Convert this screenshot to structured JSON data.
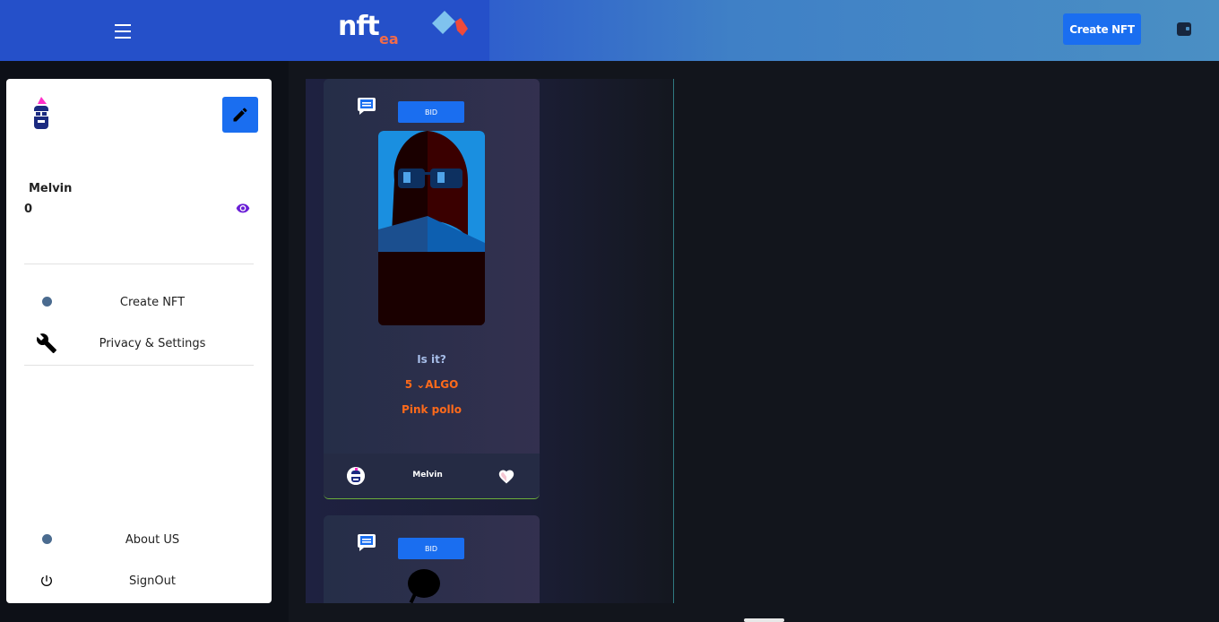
{
  "header": {
    "logo_text": "nft",
    "logo_sub": "ea",
    "create_button": "Create NFT",
    "menu_icon": "menu-icon",
    "wallet_icon": "wallet-icon"
  },
  "sidebar": {
    "username": "Melvin",
    "balance": "0",
    "items": [
      {
        "label": "Create NFT",
        "icon": "dot-icon"
      },
      {
        "label": "Privacy & Settings",
        "icon": "wrench-icon"
      },
      {
        "label": "About US",
        "icon": "dot-icon"
      },
      {
        "label": "SignOut",
        "icon": "power-icon"
      }
    ]
  },
  "cards": [
    {
      "bid_label": "BID",
      "title": "Is it?",
      "price": "5 ⌄ALGO",
      "name": "Pink pollo",
      "owner": "Melvin"
    },
    {
      "bid_label": "BID"
    }
  ],
  "colors": {
    "accent": "#1a6ef0",
    "price": "#ff6a1a",
    "topbar": "#2550c9",
    "eye": "#6a1fd6"
  }
}
